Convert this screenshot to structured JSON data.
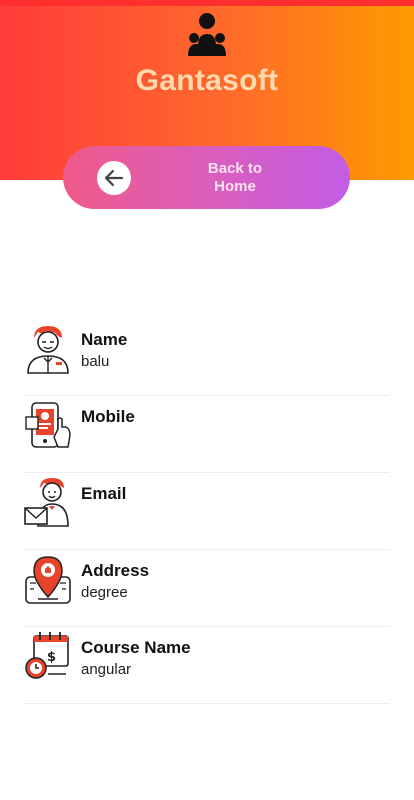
{
  "header": {
    "title": "Gantasoft",
    "profile_icon": "user-group-icon",
    "gradient": [
      "#ff3b3b",
      "#ff9a00"
    ]
  },
  "back_button": {
    "line1": "Back to",
    "line2": "Home",
    "icon": "arrow-left-icon"
  },
  "profile_fields": [
    {
      "label": "Name",
      "value": "balu",
      "icon": "person-icon"
    },
    {
      "label": "Mobile",
      "value": "",
      "icon": "mobile-phone-icon"
    },
    {
      "label": "Email",
      "value": "",
      "icon": "email-icon"
    },
    {
      "label": "Address",
      "value": "degree",
      "icon": "location-pin-icon"
    },
    {
      "label": "Course Name",
      "value": "angular",
      "icon": "course-calendar-icon"
    }
  ]
}
